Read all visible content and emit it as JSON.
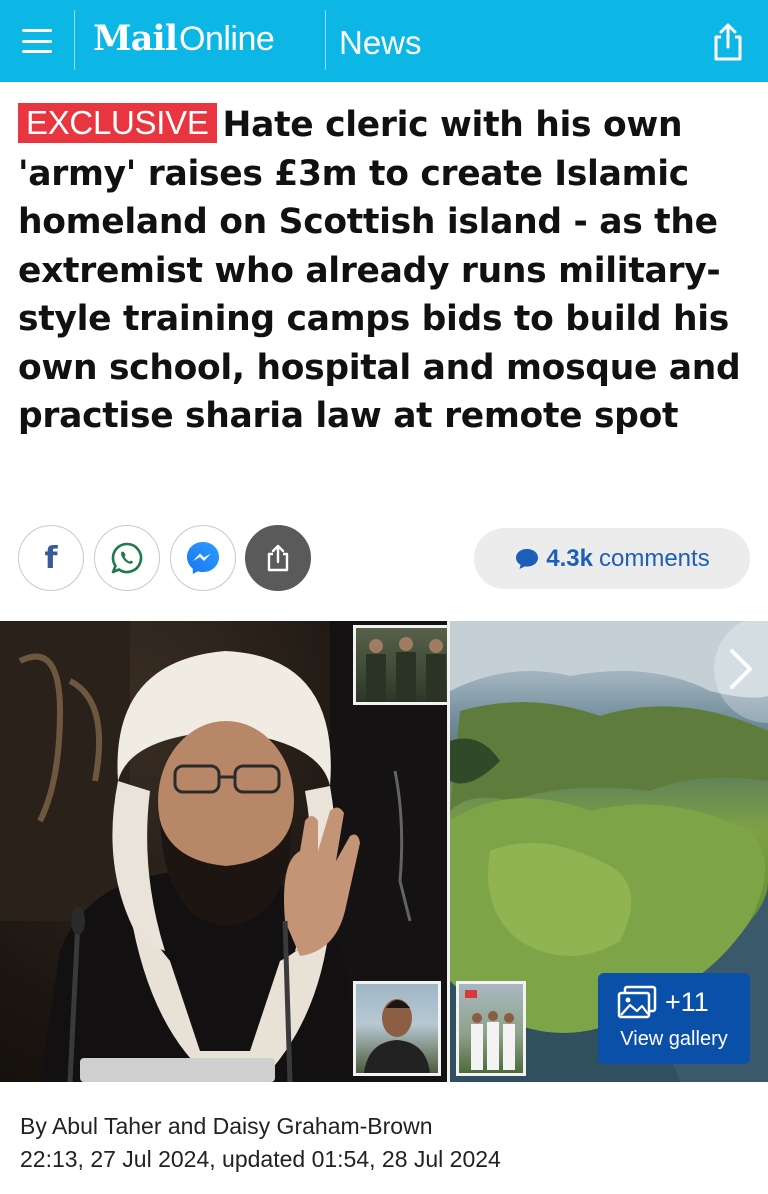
{
  "header": {
    "logo_bold": "Mail",
    "logo_light": "Online",
    "section": "News",
    "bg_color": "#0cb7e6",
    "menu_icon": "hamburger-icon",
    "share_icon": "share-icon"
  },
  "article": {
    "badge": "EXCLUSIVE",
    "badge_color": "#e8353f",
    "headline": "Hate cleric with his own 'army' raises £3m to create Islamic homeland on Scottish island - as the extremist who already runs military-style training camps bids to build his own school, hospital and mosque and practise sharia law at remote spot"
  },
  "share": {
    "buttons": [
      "facebook-icon",
      "whatsapp-icon",
      "messenger-icon",
      "share-icon"
    ],
    "comments_count": "4.3k",
    "comments_label": "comments",
    "comments_color": "#1d5fb8"
  },
  "gallery": {
    "count": "+11",
    "label": "View gallery",
    "button_color": "#0a4fa8"
  },
  "byline": {
    "authors": "By Abul Taher and Daisy Graham-Brown",
    "timestamp": "22:13, 27 Jul 2024, updated 01:54, 28 Jul 2024"
  }
}
